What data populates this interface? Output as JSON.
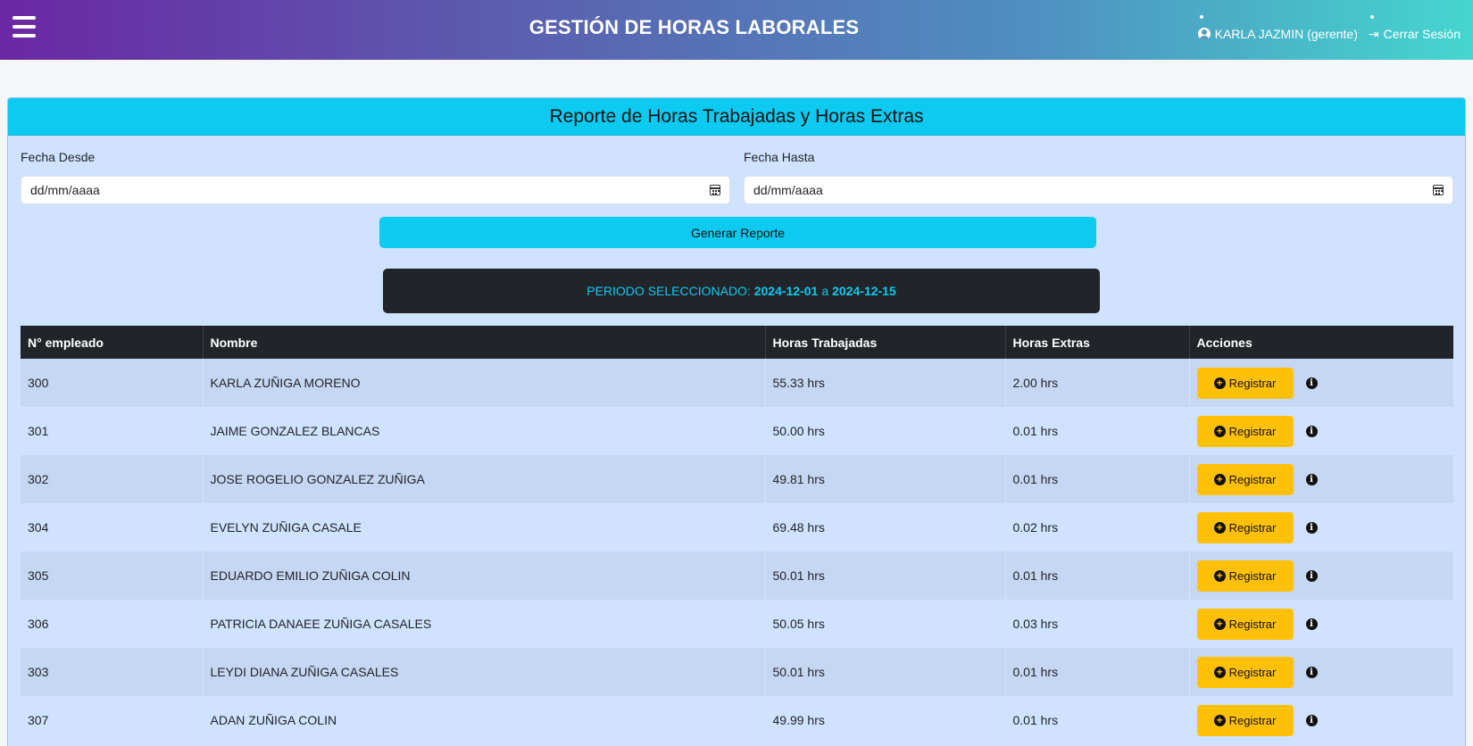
{
  "header": {
    "title": "GESTIÓN DE HORAS LABORALES",
    "user_label": "KARLA JAZMIN (gerente)",
    "logout_label": "Cerrar Sesión"
  },
  "report": {
    "title": "Reporte de Horas Trabajadas y Horas Extras",
    "from_label": "Fecha Desde",
    "from_placeholder": "dd/mm/aaaa",
    "to_label": "Fecha Hasta",
    "to_placeholder": "dd/mm/aaaa",
    "generate_label": "Generar Reporte",
    "period_prefix": "PERIODO SELECCIONADO:",
    "period_start": "2024-12-01",
    "period_sep": "a",
    "period_end": "2024-12-15"
  },
  "table": {
    "columns": [
      "N° empleado",
      "Nombre",
      "Horas Trabajadas",
      "Horas Extras",
      "Acciones"
    ],
    "register_label": "Registrar",
    "rows": [
      {
        "id": "300",
        "name": "KARLA ZUÑIGA MORENO",
        "worked": "55.33 hrs",
        "extra": "2.00 hrs"
      },
      {
        "id": "301",
        "name": "JAIME GONZALEZ BLANCAS",
        "worked": "50.00 hrs",
        "extra": "0.01 hrs"
      },
      {
        "id": "302",
        "name": "JOSE ROGELIO GONZALEZ ZUÑIGA",
        "worked": "49.81 hrs",
        "extra": "0.01 hrs"
      },
      {
        "id": "304",
        "name": "EVELYN ZUÑIGA CASALE",
        "worked": "69.48 hrs",
        "extra": "0.02 hrs"
      },
      {
        "id": "305",
        "name": "EDUARDO EMILIO ZUÑIGA COLIN",
        "worked": "50.01 hrs",
        "extra": "0.01 hrs"
      },
      {
        "id": "306",
        "name": "PATRICIA DANAEE ZUÑIGA CASALES",
        "worked": "50.05 hrs",
        "extra": "0.03 hrs"
      },
      {
        "id": "303",
        "name": "LEYDI DIANA ZUÑIGA CASALES",
        "worked": "50.01 hrs",
        "extra": "0.01 hrs"
      },
      {
        "id": "307",
        "name": "ADAN ZUÑIGA COLIN",
        "worked": "49.99 hrs",
        "extra": "0.01 hrs"
      }
    ]
  },
  "icons": {
    "menu": "menu-icon",
    "user": "user-circle-icon",
    "logout": "logout-icon",
    "calendar": "calendar-icon",
    "plus": "plus-circle-icon",
    "info": "info-circle-icon"
  },
  "colors": {
    "accent": "#0dcaf0",
    "dark": "#212529",
    "warning": "#ffc107",
    "card_bg": "#cfe2ff"
  }
}
